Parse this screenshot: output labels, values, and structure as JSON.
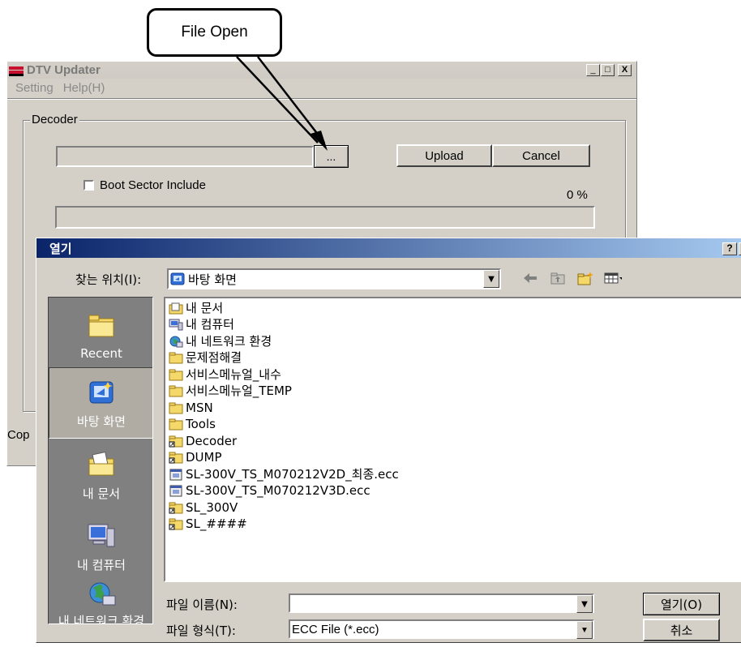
{
  "callout": {
    "text": "File Open"
  },
  "updater": {
    "title": "DTV Updater",
    "menu": [
      "Setting",
      "Help(H)"
    ],
    "window_buttons": {
      "minimize": "_",
      "maximize": "□",
      "close": "X"
    },
    "decoder_group_label": "Decoder",
    "browse_label": "...",
    "upload_label": "Upload",
    "cancel_label": "Cancel",
    "boot_sector_label": "Boot Sector Include",
    "progress_text": "0 %",
    "progress": 0,
    "status_left": "Cop"
  },
  "dialog": {
    "title": "열기",
    "help_label": "?",
    "close_label": "X",
    "lookin_label": "찾는 위치(I):",
    "lookin_value": "바탕 화면",
    "places": [
      {
        "label": "Recent",
        "icon": "recent-folder-icon"
      },
      {
        "label": "바탕 화면",
        "icon": "desktop-icon"
      },
      {
        "label": "내 문서",
        "icon": "my-documents-icon"
      },
      {
        "label": "내 컴퓨터",
        "icon": "my-computer-icon"
      },
      {
        "label": "내 네트워크 환경",
        "icon": "network-icon"
      }
    ],
    "files": [
      {
        "name": "내 문서",
        "kind": "special-folder"
      },
      {
        "name": "내 컴퓨터",
        "kind": "computer"
      },
      {
        "name": "내 네트워크 환경",
        "kind": "network"
      },
      {
        "name": "문제점해결",
        "kind": "folder"
      },
      {
        "name": "서비스메뉴얼_내수",
        "kind": "folder"
      },
      {
        "name": "서비스메뉴얼_TEMP",
        "kind": "folder"
      },
      {
        "name": "MSN",
        "kind": "folder"
      },
      {
        "name": "Tools",
        "kind": "folder"
      },
      {
        "name": "Decoder",
        "kind": "folder-shortcut"
      },
      {
        "name": "DUMP",
        "kind": "folder-shortcut"
      },
      {
        "name": "SL-300V_TS_M070212V2D_최종.ecc",
        "kind": "ecc-file"
      },
      {
        "name": "SL-300V_TS_M070212V3D.ecc",
        "kind": "ecc-file"
      },
      {
        "name": "SL_300V",
        "kind": "folder-shortcut"
      },
      {
        "name": "SL_####",
        "kind": "folder-shortcut"
      }
    ],
    "filename_label": "파일 이름(N):",
    "filename_value": "",
    "filetype_label": "파일 형식(T):",
    "filetype_value": "ECC File (*.ecc)",
    "open_label": "열기(O)",
    "cancel_label": "취소"
  },
  "colors": {
    "title_gradient_start": "#0a246a",
    "title_gradient_end": "#a6caf0",
    "window_face": "#d4d0c8",
    "places_bar": "#808080"
  }
}
